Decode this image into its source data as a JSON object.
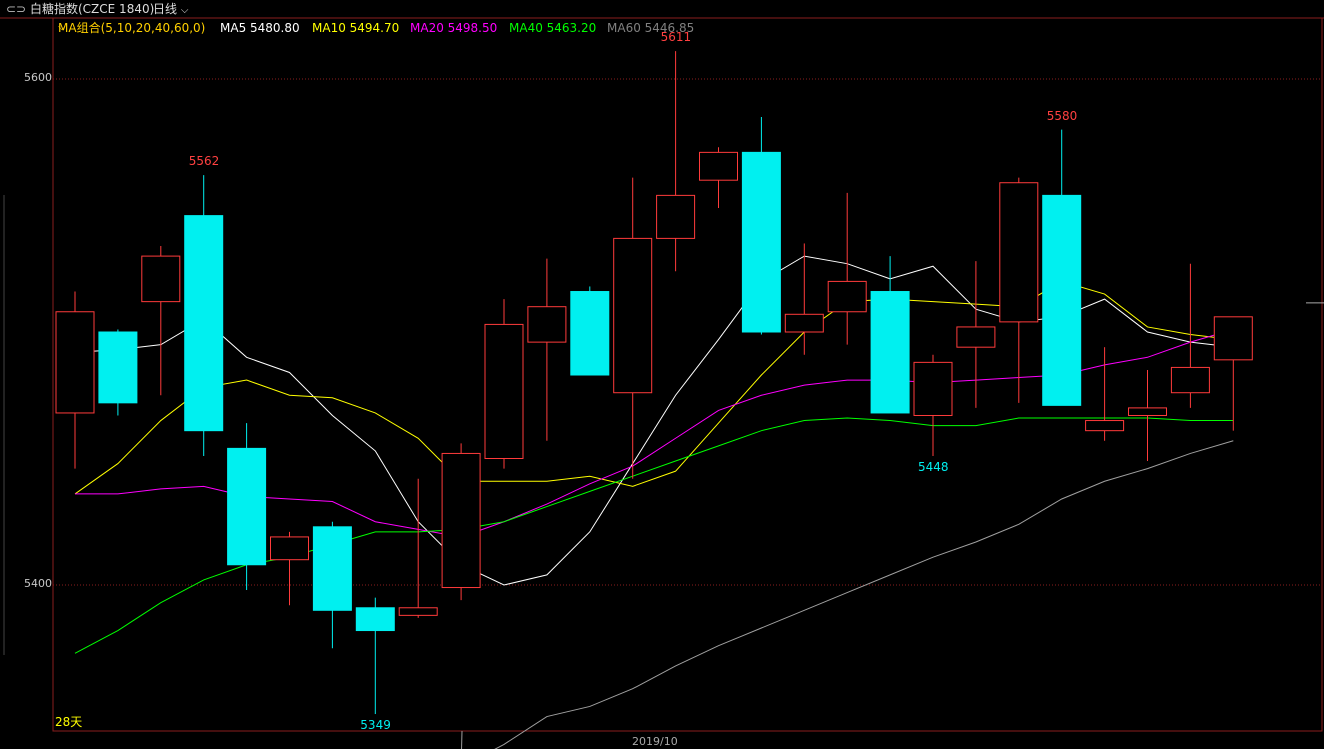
{
  "toolbar": {
    "icon": "link-icon",
    "instrument": "白糖指数(CZCE 1840)",
    "period_selector": "日线",
    "chevron": "chevron-down-icon"
  },
  "ma_legend": {
    "group_label": "MA组合(5,10,20,40,60,0)",
    "items": [
      {
        "label": "MA5 5480.80",
        "color": "#ffffff"
      },
      {
        "label": "MA10 5494.70",
        "color": "#ffff00"
      },
      {
        "label": "MA20 5498.50",
        "color": "#ff00ff"
      },
      {
        "label": "MA40 5463.20",
        "color": "#00ff00"
      },
      {
        "label": "MA60 5446.85",
        "color": "#808080"
      }
    ]
  },
  "period_label": "28天",
  "chart_data": {
    "type": "candlestick",
    "ylim": [
      5345,
      5622
    ],
    "yticks": [
      5600,
      5400
    ],
    "xlabel": "2019/10",
    "colors": {
      "up": "#ff3b3b",
      "down": "#00f0f0",
      "grid": "#8a1e1e"
    },
    "candles": [
      {
        "o": 5468,
        "h": 5516,
        "l": 5446,
        "c": 5508
      },
      {
        "o": 5500,
        "h": 5501,
        "l": 5467,
        "c": 5472
      },
      {
        "o": 5512,
        "h": 5534,
        "l": 5475,
        "c": 5530
      },
      {
        "o": 5546,
        "h": 5562,
        "l": 5451,
        "c": 5461
      },
      {
        "o": 5454,
        "h": 5464,
        "l": 5398,
        "c": 5408
      },
      {
        "o": 5410,
        "h": 5421,
        "l": 5392,
        "c": 5419
      },
      {
        "o": 5423,
        "h": 5425,
        "l": 5375,
        "c": 5390
      },
      {
        "o": 5391,
        "h": 5395,
        "l": 5349,
        "c": 5382
      },
      {
        "o": 5388,
        "h": 5442,
        "l": 5387,
        "c": 5391
      },
      {
        "o": 5399,
        "h": 5456,
        "l": 5394,
        "c": 5452
      },
      {
        "o": 5450,
        "h": 5513,
        "l": 5446,
        "c": 5503
      },
      {
        "o": 5496,
        "h": 5529,
        "l": 5457,
        "c": 5510
      },
      {
        "o": 5516,
        "h": 5518,
        "l": 5483,
        "c": 5483
      },
      {
        "o": 5476,
        "h": 5561,
        "l": 5442,
        "c": 5537
      },
      {
        "o": 5537,
        "h": 5611,
        "l": 5524,
        "c": 5554
      },
      {
        "o": 5560,
        "h": 5573,
        "l": 5549,
        "c": 5571
      },
      {
        "o": 5571,
        "h": 5585,
        "l": 5499,
        "c": 5500
      },
      {
        "o": 5500,
        "h": 5535,
        "l": 5491,
        "c": 5507
      },
      {
        "o": 5508,
        "h": 5555,
        "l": 5495,
        "c": 5520
      },
      {
        "o": 5516,
        "h": 5530,
        "l": 5469,
        "c": 5468
      },
      {
        "o": 5467,
        "h": 5491,
        "l": 5451,
        "c": 5488
      },
      {
        "o": 5494,
        "h": 5528,
        "l": 5470,
        "c": 5502
      },
      {
        "o": 5504,
        "h": 5561,
        "l": 5472,
        "c": 5559
      },
      {
        "o": 5554,
        "h": 5580,
        "l": 5471,
        "c": 5471
      },
      {
        "o": 5461,
        "h": 5494,
        "l": 5457,
        "c": 5465
      },
      {
        "o": 5467,
        "h": 5485,
        "l": 5449,
        "c": 5470
      },
      {
        "o": 5476,
        "h": 5527,
        "l": 5470,
        "c": 5486
      },
      {
        "o": 5489,
        "h": 5496,
        "l": 5461,
        "c": 5506
      }
    ],
    "ma": [
      {
        "name": "MA5",
        "color": "#ffffff",
        "values": [
          5492,
          5493,
          5495,
          5505,
          5490,
          5484,
          5467,
          5453,
          5425,
          5408,
          5400,
          5404,
          5421,
          5448,
          5475,
          5497,
          5520,
          5530,
          5527,
          5521,
          5526,
          5509,
          5504,
          5506,
          5513,
          5500,
          5496,
          5494
        ]
      },
      {
        "name": "MA10",
        "color": "#ffff00",
        "values": [
          5436,
          5448,
          5465,
          5478,
          5481,
          5475,
          5474,
          5468,
          5458,
          5441,
          5441,
          5441,
          5443,
          5439,
          5445,
          5464,
          5483,
          5500,
          5512,
          5513,
          5512,
          5511,
          5510,
          5520,
          5515,
          5502,
          5499,
          5497
        ]
      },
      {
        "name": "MA20",
        "color": "#ff00ff",
        "values": [
          5436,
          5436,
          5438,
          5439,
          5435,
          5434,
          5433,
          5425,
          5422,
          5419,
          5425,
          5432,
          5440,
          5447,
          5458,
          5469,
          5475,
          5479,
          5481,
          5481,
          5480,
          5481,
          5482,
          5483,
          5487,
          5490,
          5496,
          5501
        ]
      },
      {
        "name": "MA40",
        "color": "#00ff00",
        "values": [
          5373,
          5382,
          5393,
          5402,
          5408,
          5411,
          5416,
          5421,
          5421,
          5422,
          5425,
          5431,
          5437,
          5443,
          5449,
          5455,
          5461,
          5465,
          5466,
          5465,
          5463,
          5463,
          5466,
          5466,
          5466,
          5466,
          5465,
          5465
        ]
      },
      {
        "name": "MA60",
        "color": "#a0a0a0",
        "values": [
          null,
          null,
          null,
          null,
          null,
          null,
          null,
          null,
          null,
          5328,
          5337,
          5348,
          5352,
          5359,
          5368,
          5376,
          5383,
          5390,
          5397,
          5404,
          5411,
          5417,
          5424,
          5434,
          5441,
          5446,
          5452,
          5457
        ]
      }
    ],
    "annotations": [
      {
        "text": "5562",
        "candle": 3,
        "at": "high",
        "color": "#ff4040"
      },
      {
        "text": "5349",
        "candle": 7,
        "at": "low",
        "color": "#00f0f0"
      },
      {
        "text": "5611",
        "candle": 14,
        "at": "high",
        "color": "#ff4040"
      },
      {
        "text": "5448",
        "candle": 20,
        "at": "low",
        "color": "#00f0f0"
      },
      {
        "text": "5580",
        "candle": 23,
        "at": "high",
        "color": "#ff4040"
      }
    ]
  }
}
